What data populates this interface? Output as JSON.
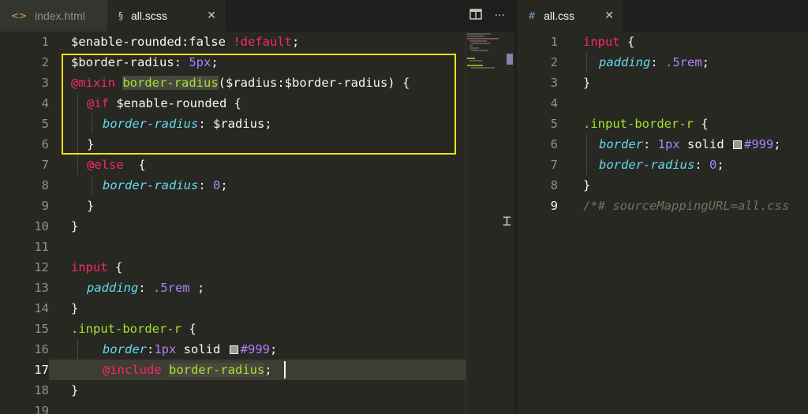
{
  "tabs_left": [
    {
      "icon": "<>",
      "label": "index.html"
    },
    {
      "icon": "§",
      "label": "all.scss",
      "close": "✕"
    }
  ],
  "tabs_right": [
    {
      "icon": "#",
      "label": "all.css",
      "close": "✕"
    }
  ],
  "toolbar": {
    "split_icon": "split-editor-icon",
    "more": "···"
  },
  "scss_lines": [
    "1",
    "2",
    "3",
    "4",
    "5",
    "6",
    "7",
    "8",
    "9",
    "10",
    "11",
    "12",
    "13",
    "14",
    "15",
    "16",
    "17",
    "18",
    "19"
  ],
  "css_lines": [
    "1",
    "2",
    "3",
    "4",
    "5",
    "6",
    "7",
    "8",
    "9"
  ],
  "scss": {
    "l1": {
      "a": "$enable-rounded:false ",
      "b": "!default",
      "c": ";"
    },
    "l2": {
      "a": "$border-radius: ",
      "b": "5px",
      "c": ";"
    },
    "l3": {
      "a": "@mixin",
      "b": " ",
      "c": "border-radius",
      "d": "($radius:$border-radius) {"
    },
    "l4": {
      "a": "@if",
      "b": " $enable-rounded {"
    },
    "l5": {
      "a": "border-radius",
      "b": ": $radius;"
    },
    "l6": {
      "a": "}"
    },
    "l7": {
      "a": "@else",
      "b": "  {"
    },
    "l8": {
      "a": "border-radius",
      "b": ": ",
      "c": "0",
      "d": ";"
    },
    "l9": {
      "a": "}"
    },
    "l10": {
      "a": "}"
    },
    "l12": {
      "a": "input",
      "b": " {"
    },
    "l13": {
      "a": "padding",
      "b": ": ",
      "c": ".5rem",
      "d": " ;"
    },
    "l14": {
      "a": "}"
    },
    "l15": {
      "a": ".input-border-r",
      "b": " {"
    },
    "l16": {
      "a": "border",
      "b": ":",
      "c": "1px",
      "d": " solid ",
      "e": "#999",
      "f": ";"
    },
    "l17": {
      "a": "@include",
      "b": " ",
      "c": "border-radius",
      "d": ";"
    },
    "l18": {
      "a": "}"
    }
  },
  "css": {
    "l1": {
      "a": "input",
      "b": " {"
    },
    "l2": {
      "a": "padding",
      "b": ": ",
      "c": ".5rem",
      "d": ";"
    },
    "l3": {
      "a": "}"
    },
    "l5": {
      "a": ".input-border-r",
      "b": " {"
    },
    "l6": {
      "a": "border",
      "b": ": ",
      "c": "1px",
      "d": " solid ",
      "e": "#999",
      "f": ";"
    },
    "l7": {
      "a": "border-radius",
      "b": ": ",
      "c": "0",
      "d": ";"
    },
    "l8": {
      "a": "}"
    },
    "l9": {
      "a": "/*# sourceMappingURL=all.css"
    }
  },
  "colors": {
    "highlight_box": "#ecdf1c",
    "swatch": "#999999",
    "background": "#272822"
  }
}
